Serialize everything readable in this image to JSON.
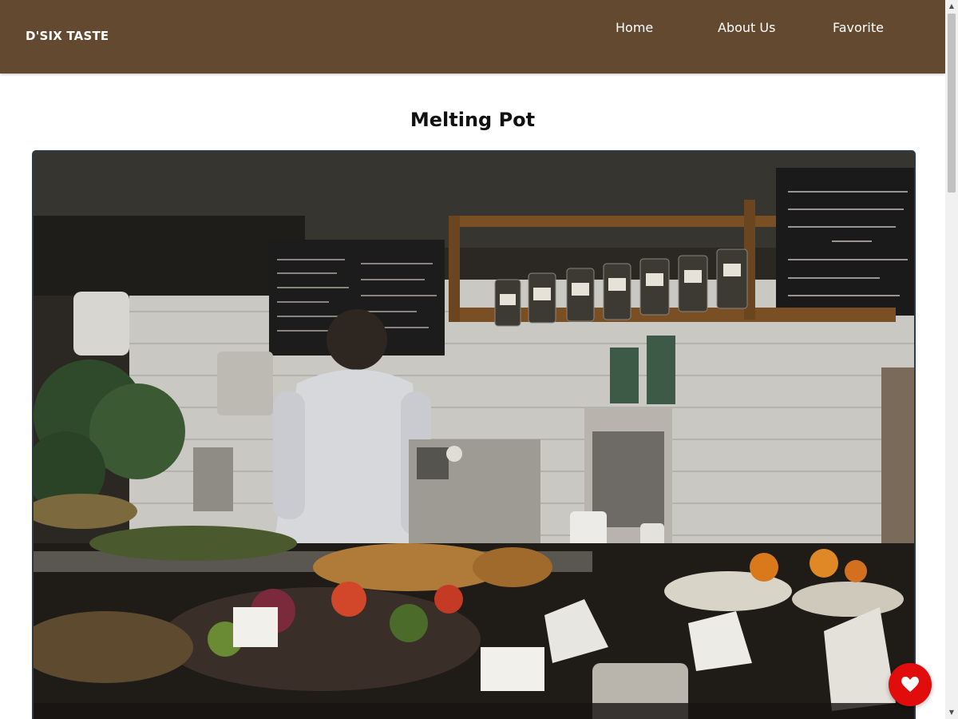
{
  "header": {
    "brand": "D'SIX TASTE",
    "nav": [
      {
        "label": "Home"
      },
      {
        "label": "About Us"
      },
      {
        "label": "Favorite"
      }
    ]
  },
  "main": {
    "title": "Melting Pot",
    "image_subject": "cafe interior with barista at espresso counter"
  },
  "fab": {
    "icon": "heart-icon"
  },
  "colors": {
    "header_bg": "#634930",
    "fab_bg": "#e10d0d"
  }
}
